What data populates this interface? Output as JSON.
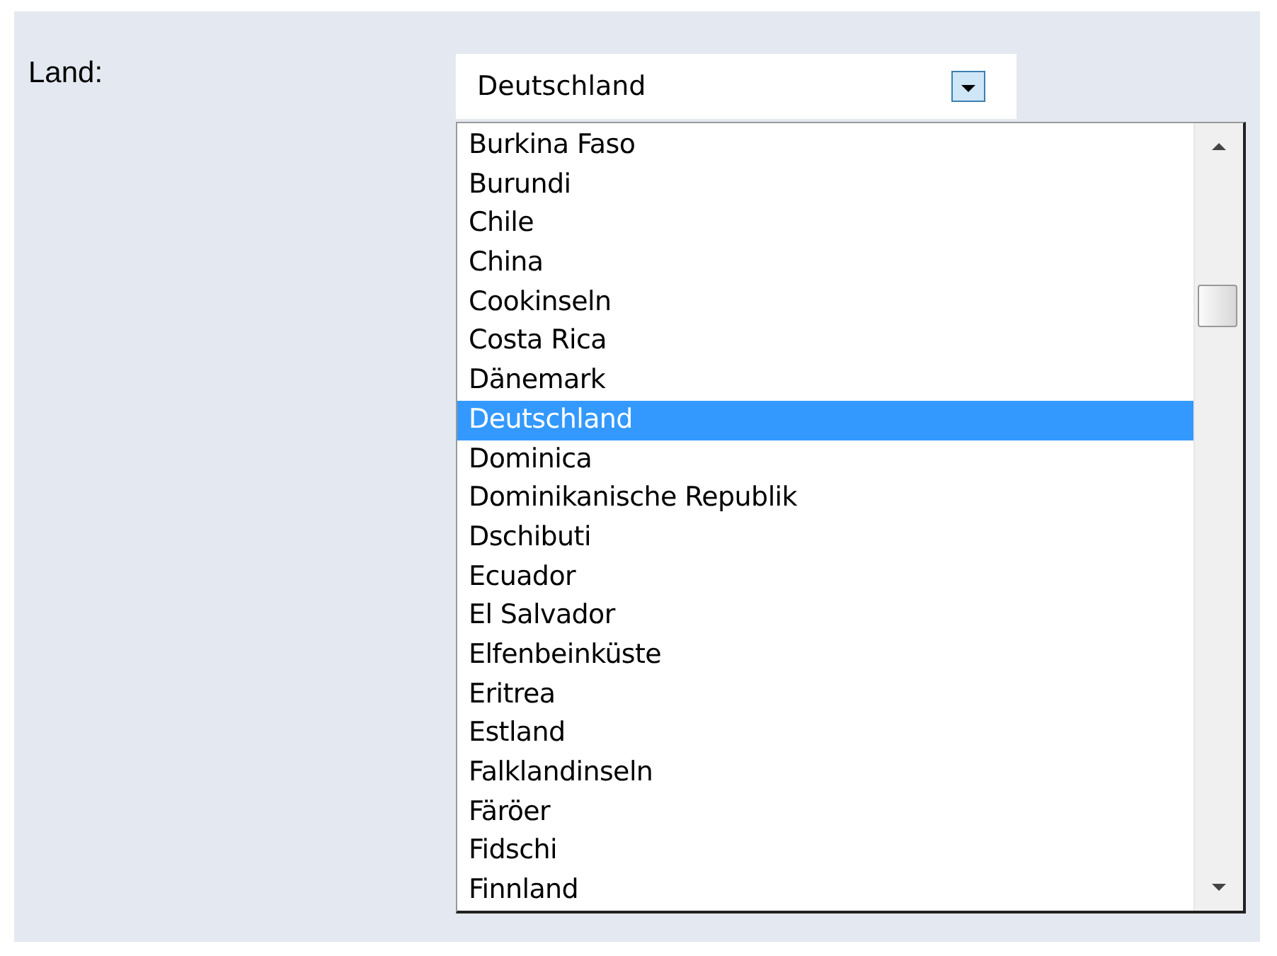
{
  "label": "Land:",
  "combo": {
    "value": "Deutschland"
  },
  "list": [
    {
      "text": "Burkina Faso",
      "selected": false
    },
    {
      "text": "Burundi",
      "selected": false
    },
    {
      "text": "Chile",
      "selected": false
    },
    {
      "text": "China",
      "selected": false
    },
    {
      "text": "Cookinseln",
      "selected": false
    },
    {
      "text": "Costa Rica",
      "selected": false
    },
    {
      "text": "Dänemark",
      "selected": false
    },
    {
      "text": "Deutschland",
      "selected": true
    },
    {
      "text": "Dominica",
      "selected": false
    },
    {
      "text": "Dominikanische Republik",
      "selected": false
    },
    {
      "text": "Dschibuti",
      "selected": false
    },
    {
      "text": "Ecuador",
      "selected": false
    },
    {
      "text": "El Salvador",
      "selected": false
    },
    {
      "text": "Elfenbeinküste",
      "selected": false
    },
    {
      "text": "Eritrea",
      "selected": false
    },
    {
      "text": "Estland",
      "selected": false
    },
    {
      "text": "Falklandinseln",
      "selected": false
    },
    {
      "text": "Färöer",
      "selected": false
    },
    {
      "text": "Fidschi",
      "selected": false
    },
    {
      "text": "Finnland",
      "selected": false
    }
  ]
}
